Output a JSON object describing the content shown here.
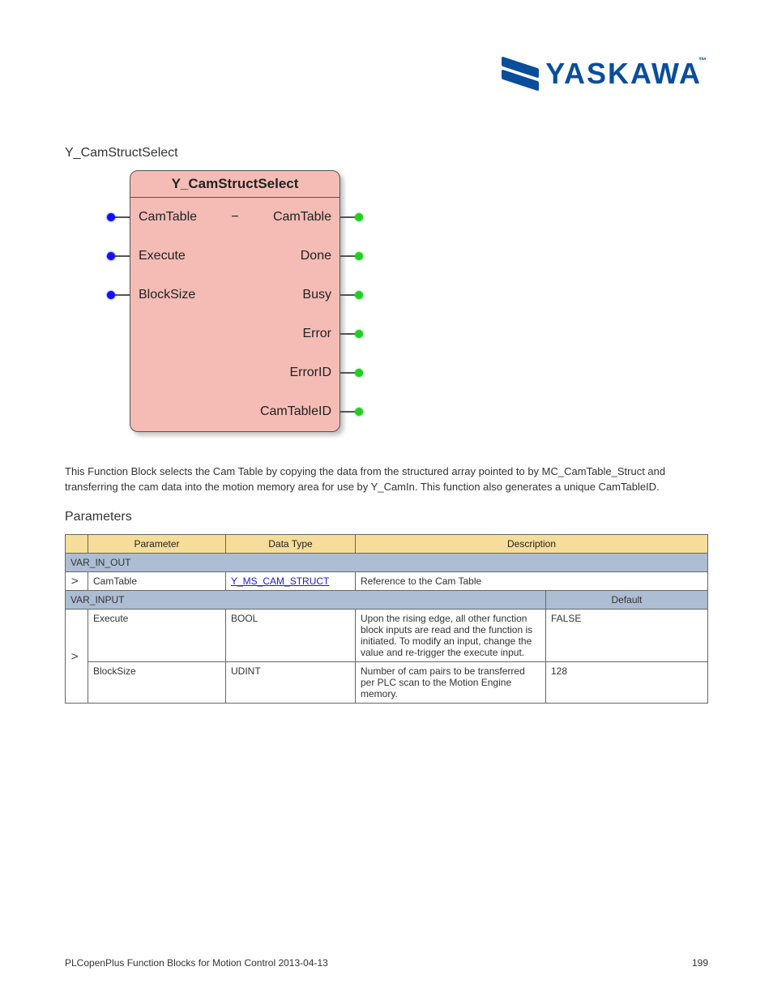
{
  "logo": {
    "text": "YASKAWA",
    "tm": "™"
  },
  "section_heading": "Y_CamStructSelect",
  "fb": {
    "title": "Y_CamStructSelect",
    "rows": [
      {
        "left": "CamTable",
        "dash": "−",
        "right": "CamTable",
        "pin_l": true,
        "pin_r": true
      },
      {
        "left": "Execute",
        "dash": "",
        "right": "Done",
        "pin_l": true,
        "pin_r": true
      },
      {
        "left": "BlockSize",
        "dash": "",
        "right": "Busy",
        "pin_l": true,
        "pin_r": true
      },
      {
        "left": "",
        "dash": "",
        "right": "Error",
        "pin_l": false,
        "pin_r": true
      },
      {
        "left": "",
        "dash": "",
        "right": "ErrorID",
        "pin_l": false,
        "pin_r": true
      },
      {
        "left": "",
        "dash": "",
        "right": "CamTableID",
        "pin_l": false,
        "pin_r": true
      }
    ]
  },
  "description": "This Function Block selects the Cam Table by copying the data from the structured array pointed to by MC_CamTable_Struct and transferring the cam data into the motion memory area for use by Y_CamIn. This function also generates a unique CamTableID.",
  "params": {
    "heading": "Parameters",
    "top_headers": [
      "",
      "Parameter",
      "Data Type",
      "Description",
      ""
    ],
    "var_in_out_label": "VAR_IN_OUT",
    "var_in_out_row": {
      "io": "V",
      "param": "CamTable",
      "type": "Y_MS_CAM_STRUCT",
      "desc": "Reference to the Cam Table"
    },
    "var_input_label": "VAR_INPUT",
    "var_input_default_header": "Default",
    "rowspan_io": "V",
    "rows": [
      {
        "param": "Execute",
        "type": "BOOL",
        "desc": "Upon the rising edge, all other function block inputs are read and the function is initiated. To modify an input, change the value and re-trigger the execute input.",
        "default": "FALSE"
      },
      {
        "param": "BlockSize",
        "type": "UDINT",
        "desc": "Number of cam pairs to be transferred per PLC scan to the Motion Engine memory.",
        "default": "128"
      }
    ]
  },
  "footer": {
    "doc": "PLCopenPlus Function Blocks for Motion Control 2013-04-13",
    "page": "199"
  }
}
